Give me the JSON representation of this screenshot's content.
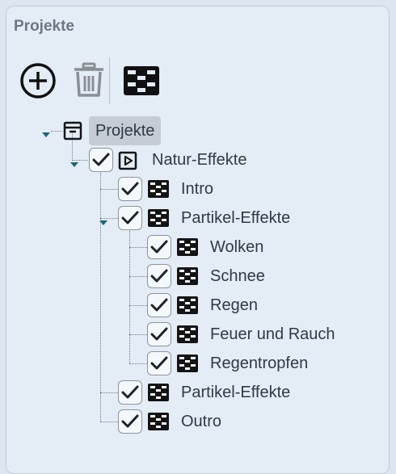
{
  "panel": {
    "title": "Projekte"
  },
  "toolbar": {
    "add_icon": "circle-plus-icon",
    "delete_icon": "trash-icon",
    "effect_icon": "effect-group-icon"
  },
  "tree": {
    "root": {
      "label": "Projekte",
      "icon": "archive-box-icon",
      "expanded": true
    },
    "project": {
      "label": "Natur-Effekte",
      "icon": "play-box-icon",
      "checked": true,
      "expanded": true
    },
    "nodes": [
      {
        "label": "Intro",
        "icon": "effect-group-icon",
        "checked": true
      },
      {
        "label": "Partikel-Effekte",
        "icon": "effect-group-icon",
        "checked": true,
        "expanded": true
      },
      {
        "label": "Wolken",
        "icon": "effect-group-icon",
        "checked": true
      },
      {
        "label": "Schnee",
        "icon": "effect-group-icon",
        "checked": true
      },
      {
        "label": "Regen",
        "icon": "effect-group-icon",
        "checked": true
      },
      {
        "label": "Feuer und Rauch",
        "icon": "effect-group-icon",
        "checked": true
      },
      {
        "label": "Regentropfen",
        "icon": "effect-group-icon",
        "checked": true
      },
      {
        "label": "Partikel-Effekte",
        "icon": "effect-group-icon",
        "checked": true
      },
      {
        "label": "Outro",
        "icon": "effect-group-icon",
        "checked": true
      }
    ]
  },
  "colors": {
    "accent": "#1c6778",
    "panel_bg": "#e4ecf6",
    "selection_bg": "#c5ccd4"
  }
}
